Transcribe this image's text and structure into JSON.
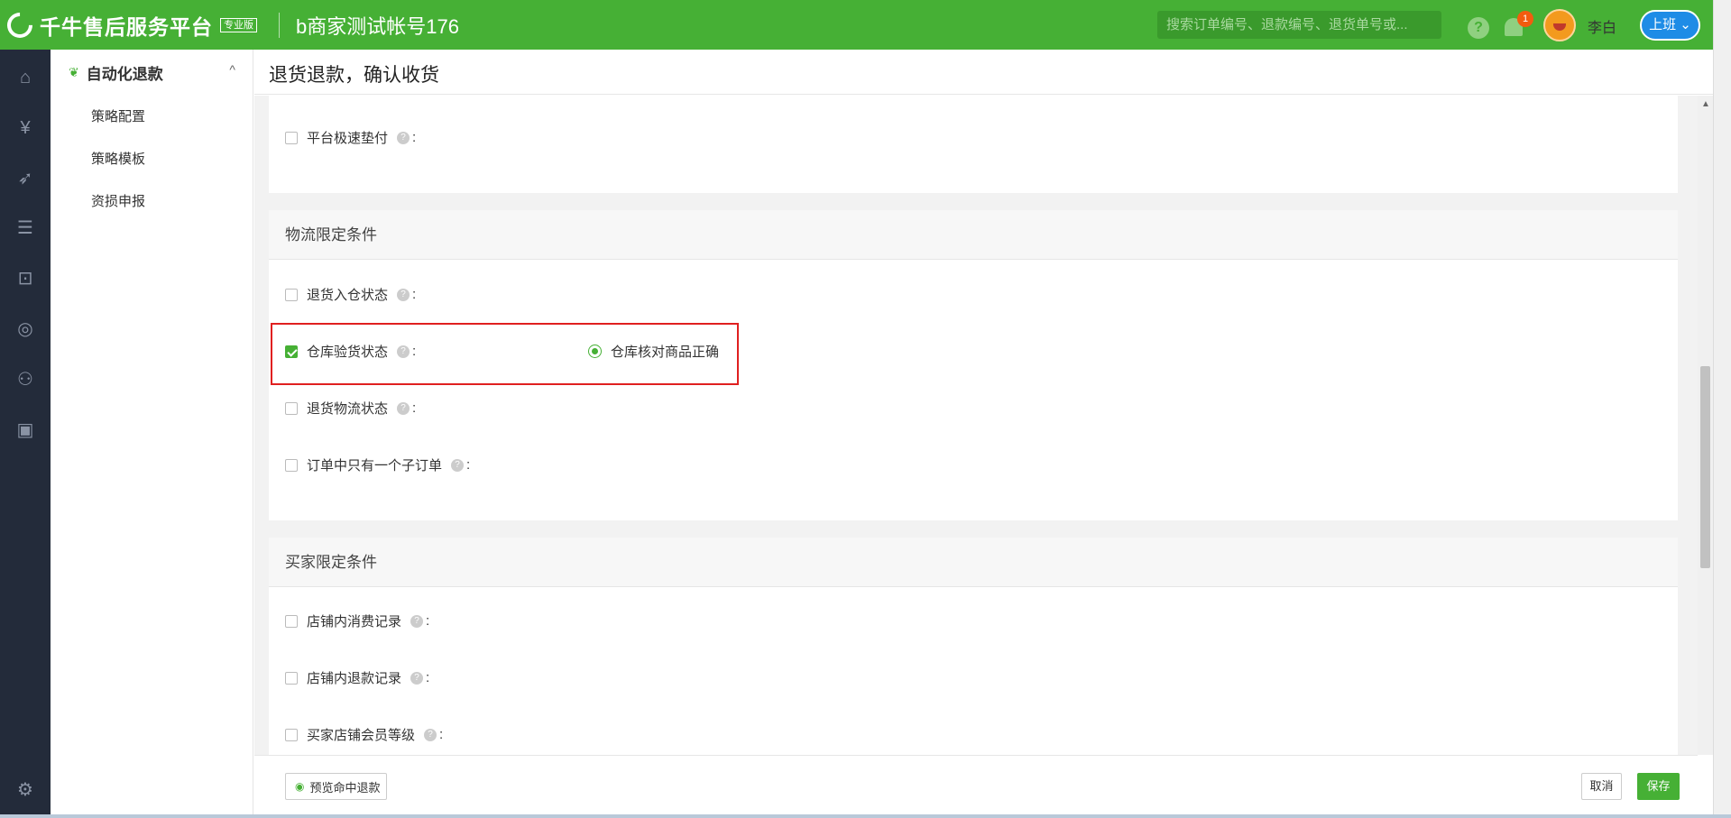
{
  "app": {
    "name": "千牛售后服务平台",
    "edition": "专业版",
    "account": "b商家测试帐号176",
    "search_placeholder": "搜索订单编号、退款编号、退货单号或...",
    "notification_count": "1",
    "username": "李白",
    "shift_label": "上班",
    "accent_color": "#46b035"
  },
  "subnav": {
    "title": "自动化退款",
    "items": [
      {
        "label": "策略配置"
      },
      {
        "label": "策略模板"
      },
      {
        "label": "资损申报"
      }
    ]
  },
  "page": {
    "title": "退货退款，确认收货"
  },
  "sections": {
    "top": {
      "rows": [
        {
          "label": "平台极速垫付",
          "checked": false
        }
      ]
    },
    "logistics": {
      "title": "物流限定条件",
      "rows": [
        {
          "label": "退货入仓状态",
          "checked": false
        },
        {
          "label": "仓库验货状态",
          "checked": true,
          "option": "仓库核对商品正确"
        },
        {
          "label": "退货物流状态",
          "checked": false
        },
        {
          "label": "订单中只有一个子订单",
          "checked": false
        }
      ]
    },
    "buyer": {
      "title": "买家限定条件",
      "rows": [
        {
          "label": "店铺内消费记录",
          "checked": false
        },
        {
          "label": "店铺内退款记录",
          "checked": false
        },
        {
          "label": "买家店铺会员等级",
          "checked": false
        }
      ]
    }
  },
  "footer": {
    "preview_label": "预览命中退款",
    "cancel_label": "取消",
    "save_label": "保存"
  },
  "icons": {
    "sidebar": [
      "home-icon",
      "yuan-icon",
      "rocket-icon",
      "list-icon",
      "refund-icon",
      "compass-icon",
      "users-icon",
      "calendar-icon",
      "settings-icon"
    ]
  }
}
